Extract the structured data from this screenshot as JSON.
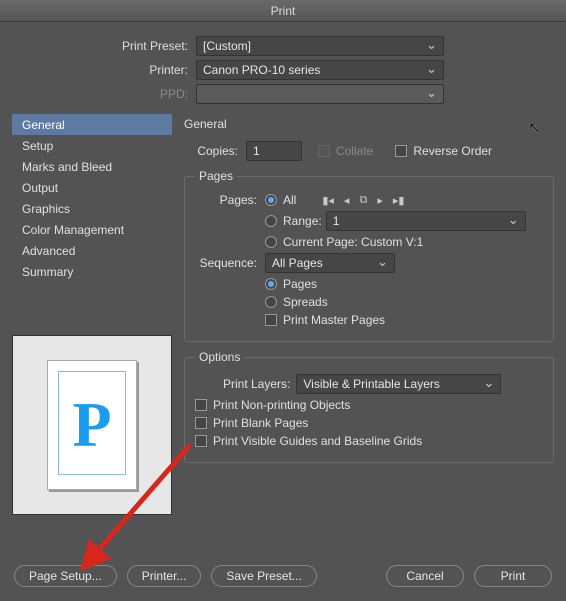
{
  "window_title": "Print",
  "top": {
    "preset_label": "Print Preset:",
    "preset_value": "[Custom]",
    "printer_label": "Printer:",
    "printer_value": "Canon PRO-10 series",
    "ppd_label": "PPD:",
    "ppd_value": ""
  },
  "sidebar": {
    "items": [
      "General",
      "Setup",
      "Marks and Bleed",
      "Output",
      "Graphics",
      "Color Management",
      "Advanced",
      "Summary"
    ],
    "selected_index": 0
  },
  "panel": {
    "heading": "General",
    "copies_label": "Copies:",
    "copies_value": "1",
    "collate_label": "Collate",
    "reverse_label": "Reverse Order",
    "pages_legend": "Pages",
    "pages_label": "Pages:",
    "pages_all": "All",
    "pages_range_label": "Range:",
    "pages_range_value": "1",
    "pages_current": "Current Page: Custom V:1",
    "sequence_label": "Sequence:",
    "sequence_value": "All Pages",
    "opt_pages": "Pages",
    "opt_spreads": "Spreads",
    "opt_print_master": "Print Master Pages",
    "options_legend": "Options",
    "print_layers_label": "Print Layers:",
    "print_layers_value": "Visible & Printable Layers",
    "opt_nonprinting": "Print Non-printing Objects",
    "opt_blank": "Print Blank Pages",
    "opt_guides": "Print Visible Guides and Baseline Grids"
  },
  "preview": {
    "letter": "P"
  },
  "buttons": {
    "page_setup": "Page Setup...",
    "printer": "Printer...",
    "save_preset": "Save Preset...",
    "cancel": "Cancel",
    "print": "Print"
  }
}
